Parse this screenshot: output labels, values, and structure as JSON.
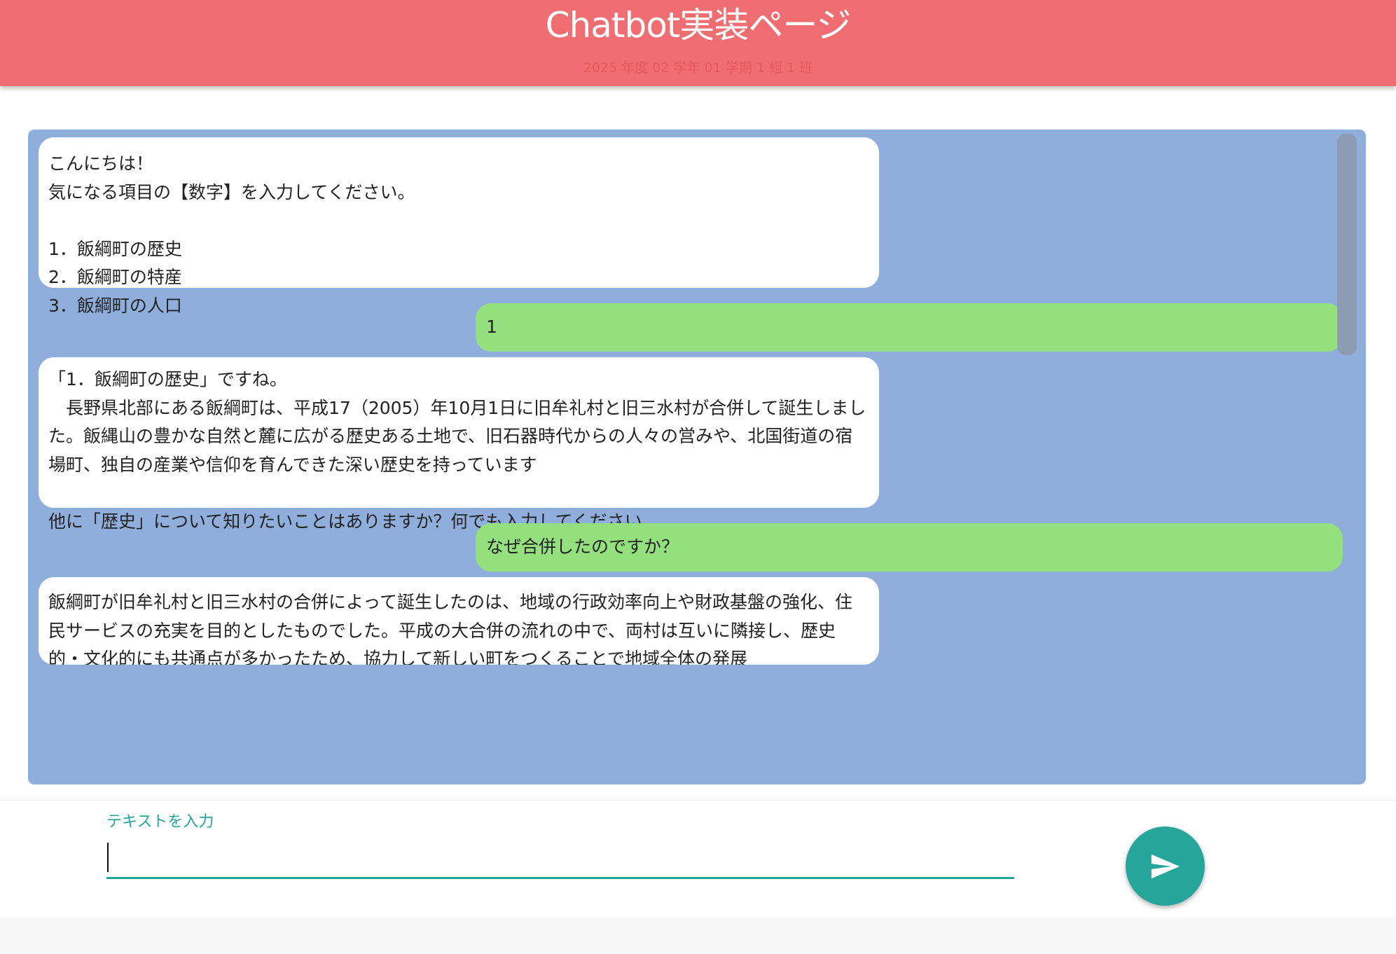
{
  "header": {
    "title": "Chatbot実装ページ",
    "subtitle": "2025 年度 02 学年 01 学期 1 組 1 班"
  },
  "chat": {
    "messages": [
      {
        "role": "bot",
        "text": "こんにちは！\n気になる項目の【数字】を入力してください。\n\n1．飯綱町の歴史\n2．飯綱町の特産\n3．飯綱町の人口"
      },
      {
        "role": "user",
        "text": "1"
      },
      {
        "role": "bot",
        "text": "「1．飯綱町の歴史」ですね。\n　長野県北部にある飯綱町は、平成17（2005）年10月1日に旧牟礼村と旧三水村が合併して誕生しました。飯縄山の豊かな自然と麓に広がる歴史ある土地で、旧石器時代からの人々の営みや、北国街道の宿場町、独自の産業や信仰を育んできた深い歴史を持っています\n\n他に「歴史」について知りたいことはありますか？何でも入力してください。"
      },
      {
        "role": "user",
        "text": "なぜ合併したのですか？"
      },
      {
        "role": "bot",
        "text": "飯綱町が旧牟礼村と旧三水村の合併によって誕生したのは、地域の行政効率向上や財政基盤の強化、住民サービスの充実を目的としたものでした。平成の大合併の流れの中で、両村は互いに隣接し、歴史的・文化的にも共通点が多かったため、協力して新しい町をつくることで地域全体の発展"
      }
    ]
  },
  "input": {
    "label": "テキストを入力",
    "value": ""
  },
  "icons": {
    "send": "send-icon"
  },
  "colors": {
    "header": "#f06e72",
    "chat_background": "#8faedb",
    "user_bubble": "#94e07f",
    "bot_bubble": "#ffffff",
    "accent": "#26a69a"
  }
}
